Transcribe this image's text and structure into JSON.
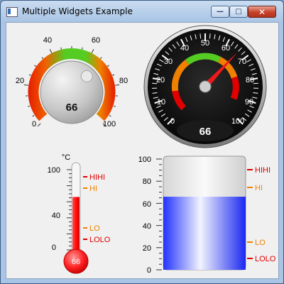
{
  "window": {
    "title": "Multiple Widgets Example",
    "controls": {
      "minimize": "—",
      "maximize": "□",
      "close": "✕"
    }
  },
  "knob_gauge": {
    "ticks": [
      "0",
      "20",
      "40",
      "60",
      "80",
      "100"
    ],
    "value_label": "66",
    "value": 66,
    "range": [
      0,
      100
    ]
  },
  "speed_gauge": {
    "ticks": [
      "0",
      "10",
      "20",
      "30",
      "40",
      "50",
      "60",
      "70",
      "80",
      "90",
      "100"
    ],
    "value_label": "66",
    "value": 66,
    "range": [
      0,
      100
    ]
  },
  "thermometer": {
    "unit": "°C",
    "ticks": [
      "100",
      "40",
      "0"
    ],
    "value_label": "66",
    "value": 66,
    "markers": {
      "hihi": "HIHI",
      "hi": "HI",
      "lo": "LO",
      "lolo": "LOLO"
    }
  },
  "tank": {
    "ticks": [
      "100",
      "80",
      "60",
      "40",
      "20",
      "0"
    ],
    "value": 66,
    "markers": {
      "hihi": "HIHI",
      "hi": "HI",
      "lo": "LO",
      "lolo": "LOLO"
    }
  },
  "colors": {
    "alarm_red": "#e00000",
    "warn_orange": "#f08000",
    "ok_green": "#55cc22",
    "tank_blue": "#2b3cff"
  }
}
